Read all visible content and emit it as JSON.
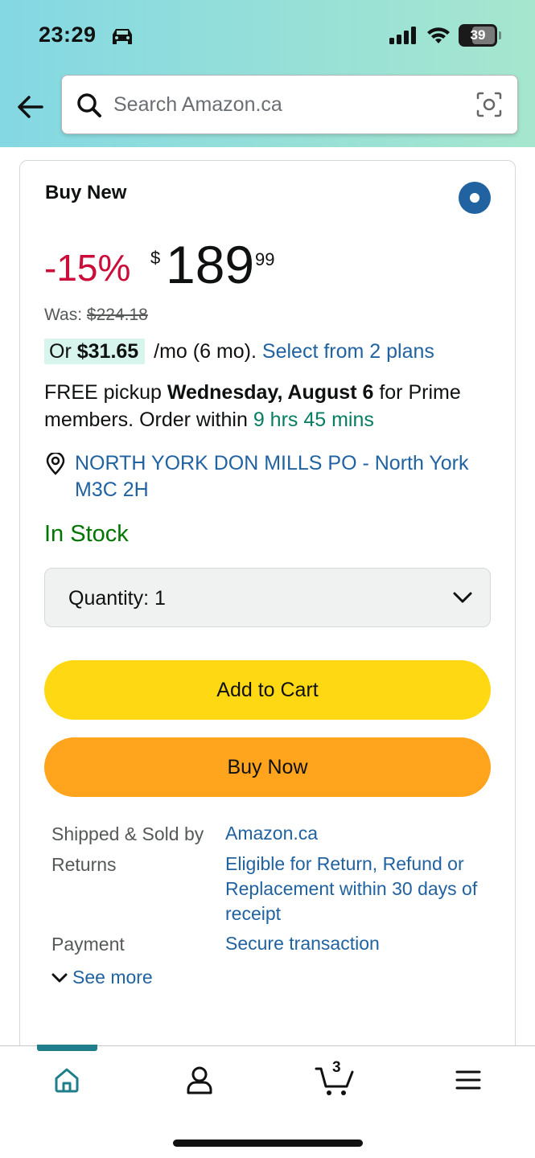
{
  "status_bar": {
    "time": "23:29",
    "battery": "39"
  },
  "search": {
    "placeholder": "Search Amazon.ca"
  },
  "offer": {
    "title": "Buy New",
    "discount": "-15%",
    "currency_symbol": "$",
    "price_whole": "189",
    "price_fraction": "99",
    "was_label": "Was:",
    "was_price": "$224.18",
    "monthly_prefix": "Or",
    "monthly_amount": "$31.65",
    "monthly_suffix": "/mo (6 mo).",
    "plans_link": "Select from 2 plans",
    "pickup_prefix": "FREE pickup",
    "pickup_date": "Wednesday, August 6",
    "pickup_suffix": "for Prime members. Order within",
    "countdown": "9 hrs 45 mins",
    "location": "NORTH YORK DON MILLS PO - North York M3C 2H",
    "availability": "In Stock",
    "quantity_label": "Quantity:",
    "quantity_value": "1",
    "add_to_cart": "Add to Cart",
    "buy_now": "Buy Now"
  },
  "details": {
    "shipped_label": "Shipped & Sold by",
    "shipped_value": "Amazon.ca",
    "returns_label": "Returns",
    "returns_value": "Eligible for Return, Refund or Replacement within 30 days of receipt",
    "payment_label": "Payment",
    "payment_value": "Secure transaction",
    "see_more": "See more"
  },
  "bottom_nav": {
    "cart_count": "3",
    "active_tab": "home"
  },
  "colors": {
    "accent_link": "#2162a1",
    "discount_red": "#cc0c39",
    "stock_green": "#007600",
    "add_to_cart_yellow": "#ffd814",
    "buy_now_orange": "#ffa41c",
    "nav_active": "#1f7e89"
  }
}
